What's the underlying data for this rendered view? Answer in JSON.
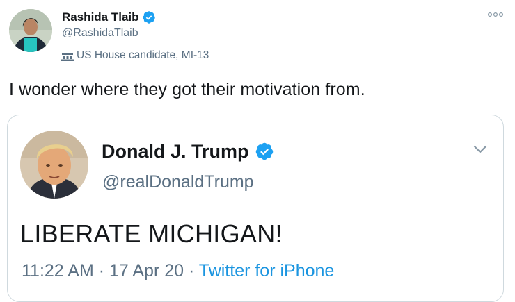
{
  "outer_tweet": {
    "display_name": "Rashida Tlaib",
    "handle": "@RashidaTlaib",
    "account_label": "US House candidate, MI-13",
    "text": "I wonder where they got their motivation from."
  },
  "quoted_tweet": {
    "display_name": "Donald J. Trump",
    "handle": "@realDonaldTrump",
    "text": "LIBERATE MICHIGAN!",
    "time": "11:22 AM",
    "separator_1": " · ",
    "date": "17 Apr 20",
    "separator_2": " · ",
    "source": "Twitter for iPhone"
  },
  "icons": {
    "verified": "verified-badge-icon",
    "label": "government-building-icon",
    "more": "more-options-icon",
    "chevron": "chevron-down-icon"
  },
  "colors": {
    "verified_blue": "#1da1f2",
    "secondary_text": "#5b7083",
    "link_blue": "#1b95e0",
    "border": "#cfd9de"
  }
}
